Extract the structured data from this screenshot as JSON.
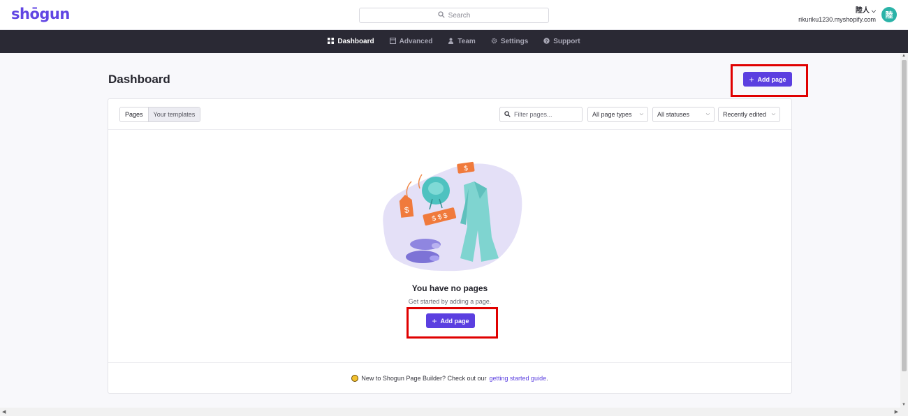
{
  "header": {
    "logo": "shōgun",
    "search_placeholder": "Search",
    "account_name": "陸人",
    "store_url": "rikuriku1230.myshopify.com",
    "avatar_initial": "陸"
  },
  "nav": {
    "items": [
      {
        "label": "Dashboard",
        "icon": "grid-icon",
        "active": true
      },
      {
        "label": "Advanced",
        "icon": "window-icon"
      },
      {
        "label": "Team",
        "icon": "user-icon"
      },
      {
        "label": "Settings",
        "icon": "gear-icon"
      },
      {
        "label": "Support",
        "icon": "question-icon"
      }
    ]
  },
  "page": {
    "title": "Dashboard",
    "add_page_label": "Add page"
  },
  "tabs": [
    {
      "label": "Pages",
      "active": true
    },
    {
      "label": "Your templates"
    }
  ],
  "filters": {
    "filter_placeholder": "Filter pages...",
    "page_types": "All page types",
    "statuses": "All statuses",
    "sort": "Recently edited"
  },
  "empty": {
    "title": "You have no pages",
    "subtitle": "Get started by adding a page.",
    "add_page_label": "Add page"
  },
  "footer": {
    "text": "New to Shogun Page Builder? Check out our",
    "link": "getting started guide",
    "end": "."
  },
  "colors": {
    "accent": "#5b3fe0",
    "nav_bg": "#2a2934",
    "highlight": "#e00000",
    "avatar": "#2bb3a8"
  }
}
